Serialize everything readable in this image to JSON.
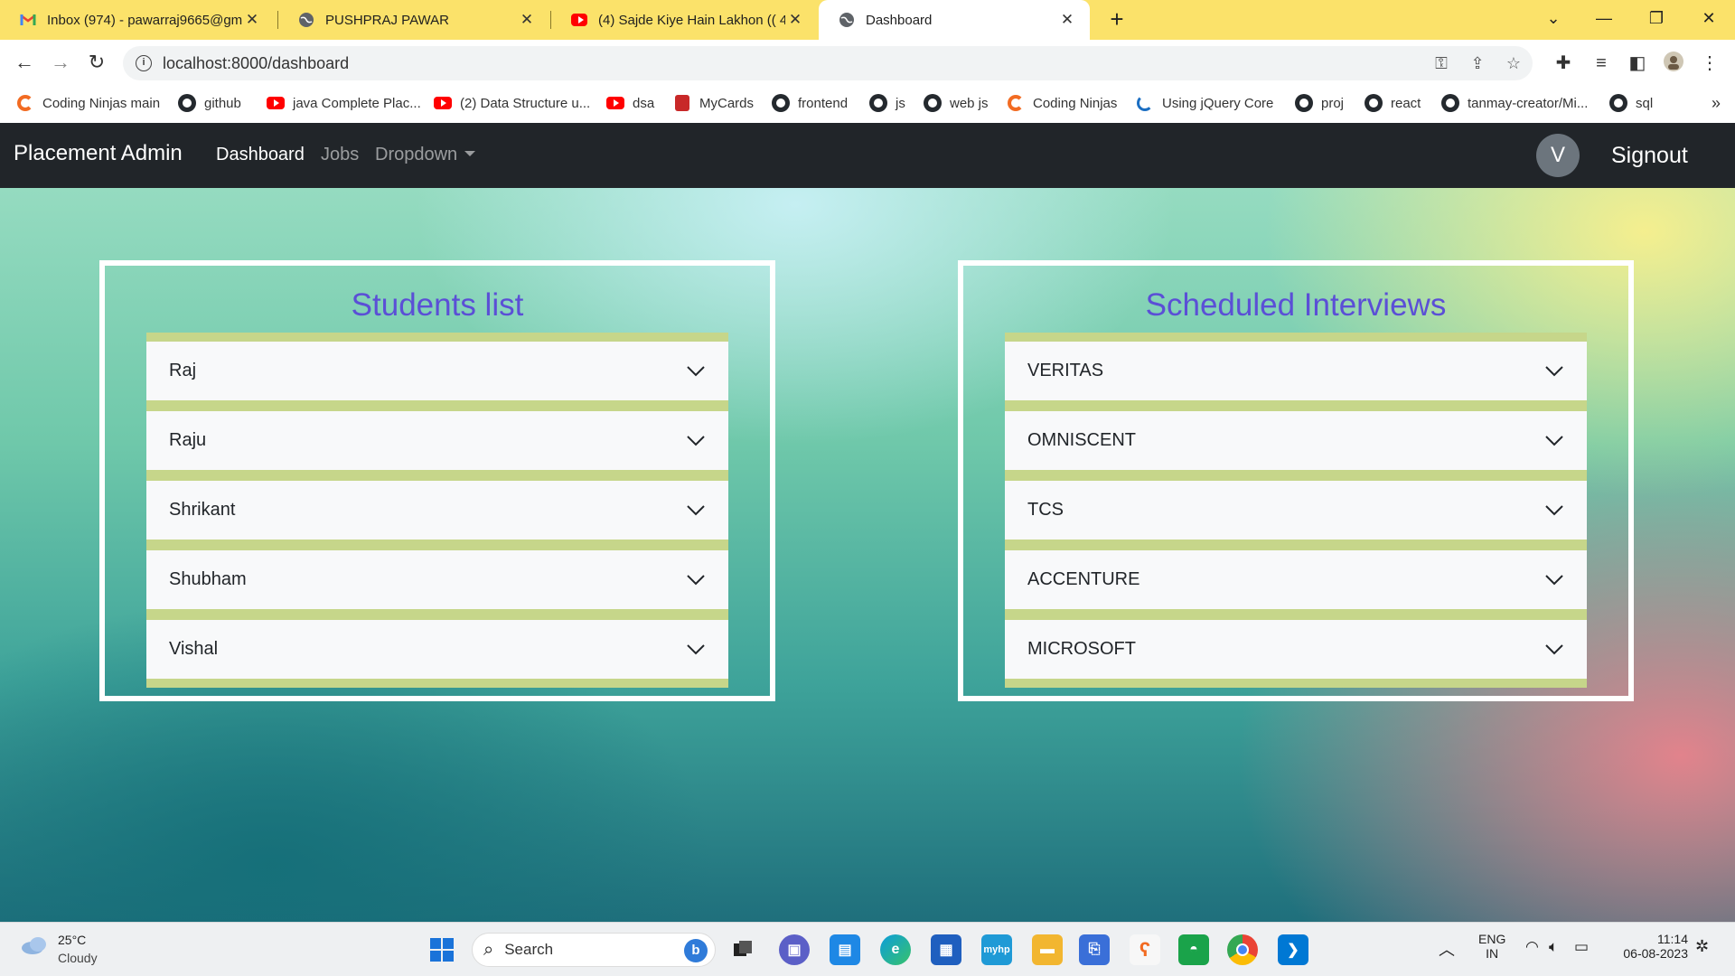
{
  "browser": {
    "tabs": [
      {
        "title": "Inbox (974) - pawarraj9665@gma",
        "icon": "gmail-icon",
        "active": false
      },
      {
        "title": "PUSHPRAJ PAWAR",
        "icon": "globe-icon",
        "active": false
      },
      {
        "title": "(4) Sajde Kiye Hain Lakhon (( 4K",
        "icon": "youtube-icon",
        "active": false
      },
      {
        "title": "Dashboard",
        "icon": "globe-icon",
        "active": true
      }
    ],
    "url": "localhost:8000/dashboard",
    "bookmarks": [
      {
        "label": "Coding Ninjas main",
        "icon": "coding-ninjas-icon"
      },
      {
        "label": "github",
        "icon": "github-icon"
      },
      {
        "label": "java Complete Plac...",
        "icon": "youtube-icon"
      },
      {
        "label": "(2) Data Structure u...",
        "icon": "youtube-icon"
      },
      {
        "label": "dsa",
        "icon": "youtube-icon"
      },
      {
        "label": "MyCards",
        "icon": "mycards-icon"
      },
      {
        "label": "frontend",
        "icon": "github-icon"
      },
      {
        "label": "js",
        "icon": "github-icon"
      },
      {
        "label": "web js",
        "icon": "github-icon"
      },
      {
        "label": "Coding Ninjas",
        "icon": "coding-ninjas-icon"
      },
      {
        "label": "Using jQuery Core",
        "icon": "jquery-icon"
      },
      {
        "label": "proj",
        "icon": "github-icon"
      },
      {
        "label": "react",
        "icon": "github-icon"
      },
      {
        "label": "tanmay-creator/Mi...",
        "icon": "github-icon"
      },
      {
        "label": "sql",
        "icon": "github-icon"
      }
    ]
  },
  "app": {
    "brand": "Placement Admin",
    "nav": [
      {
        "label": "Dashboard",
        "active": true
      },
      {
        "label": "Jobs",
        "active": false
      },
      {
        "label": "Dropdown",
        "active": false
      }
    ],
    "avatar_initial": "V",
    "signout_label": "Signout"
  },
  "students": {
    "title": "Students list",
    "items": [
      "Raj",
      "Raju",
      "Shrikant",
      "Shubham",
      "Vishal"
    ]
  },
  "interviews": {
    "title": "Scheduled Interviews",
    "items": [
      "VERITAS",
      "OMNISCENT",
      "TCS",
      "ACCENTURE",
      "MICROSOFT"
    ]
  },
  "taskbar": {
    "weather_temp": "25°C",
    "weather_condition": "Cloudy",
    "search_placeholder": "Search",
    "language_line1": "ENG",
    "language_line2": "IN",
    "time": "11:14",
    "date": "06-08-2023"
  },
  "colors": {
    "navbar": "#212529",
    "panel_title": "#5b4fd6",
    "accordion_band": "#c6d68a",
    "tabstrip": "#fbe26a"
  }
}
